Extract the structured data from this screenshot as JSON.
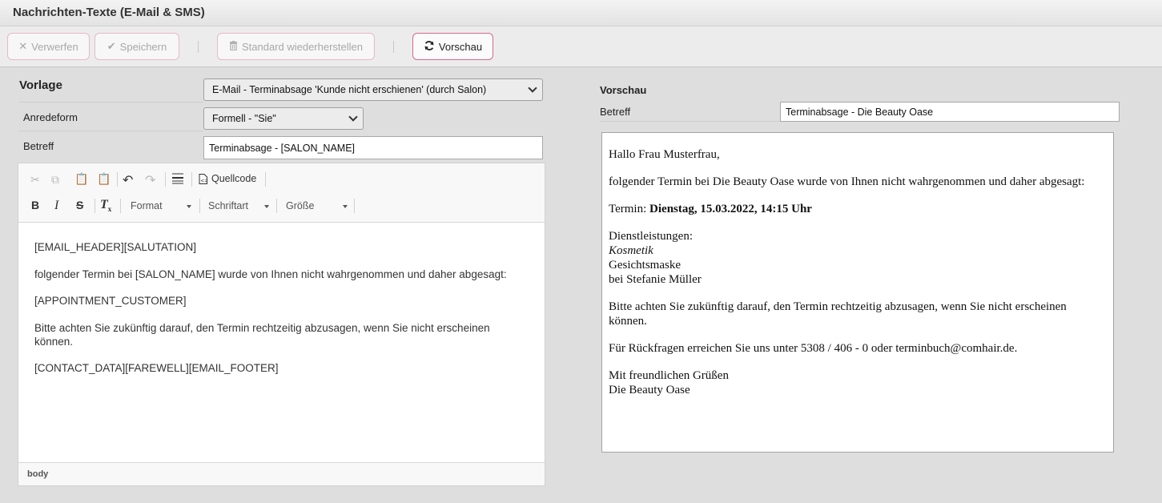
{
  "window": {
    "title": "Nachrichten-Texte (E-Mail & SMS)"
  },
  "toolbar": {
    "discard_label": "Verwerfen",
    "save_label": "Speichern",
    "restore_label": "Standard wiederherstellen",
    "preview_label": "Vorschau"
  },
  "form": {
    "template_label": "Vorlage",
    "template_value": "E-Mail - Terminabsage 'Kunde nicht erschienen' (durch Salon)",
    "salutation_label": "Anredeform",
    "salutation_value": "Formell - \"Sie\"",
    "subject_label": "Betreff",
    "subject_value": "Terminabsage - [SALON_NAME]"
  },
  "editor": {
    "source_label": "Quellcode",
    "format_label": "Format",
    "font_label": "Schriftart",
    "size_label": "Größe",
    "paragraphs": [
      "[EMAIL_HEADER][SALUTATION]",
      "folgender Termin bei [SALON_NAME] wurde von Ihnen nicht wahrgenommen und daher abgesagt:",
      "[APPOINTMENT_CUSTOMER]",
      "Bitte achten Sie zukünftig darauf, den Termin rechtzeitig abzusagen, wenn Sie nicht erscheinen können.",
      "[CONTACT_DATA][FAREWELL][EMAIL_FOOTER]"
    ],
    "path": "body"
  },
  "preview": {
    "heading": "Vorschau",
    "subject_label": "Betreff",
    "subject_value": "Terminabsage - Die Beauty Oase",
    "greeting": "Hallo Frau Musterfrau,",
    "intro": "folgender Termin bei Die Beauty Oase wurde von Ihnen nicht wahrgenommen und daher abgesagt:",
    "termin_prefix": "Termin: ",
    "termin_value": "Dienstag, 15.03.2022, 14:15 Uhr",
    "services_label": "Dienstleistungen:",
    "service_category": "Kosmetik",
    "service_name": "Gesichtsmaske",
    "service_staff": "bei Stefanie Müller",
    "notice": "Bitte achten Sie zukünftig darauf, den Termin rechtzeitig abzusagen, wenn Sie nicht erscheinen können.",
    "contact": "Für Rückfragen erreichen Sie uns unter 5308 / 406 - 0 oder terminbuch@comhair.de.",
    "farewell": "Mit freundlichen Grüßen",
    "signature": "Die Beauty Oase"
  },
  "icons": {
    "discard": "close-icon",
    "save": "check-icon",
    "restore": "trash-icon",
    "preview": "refresh-icon"
  },
  "colors": {
    "accent_border": "#d46a8e"
  }
}
